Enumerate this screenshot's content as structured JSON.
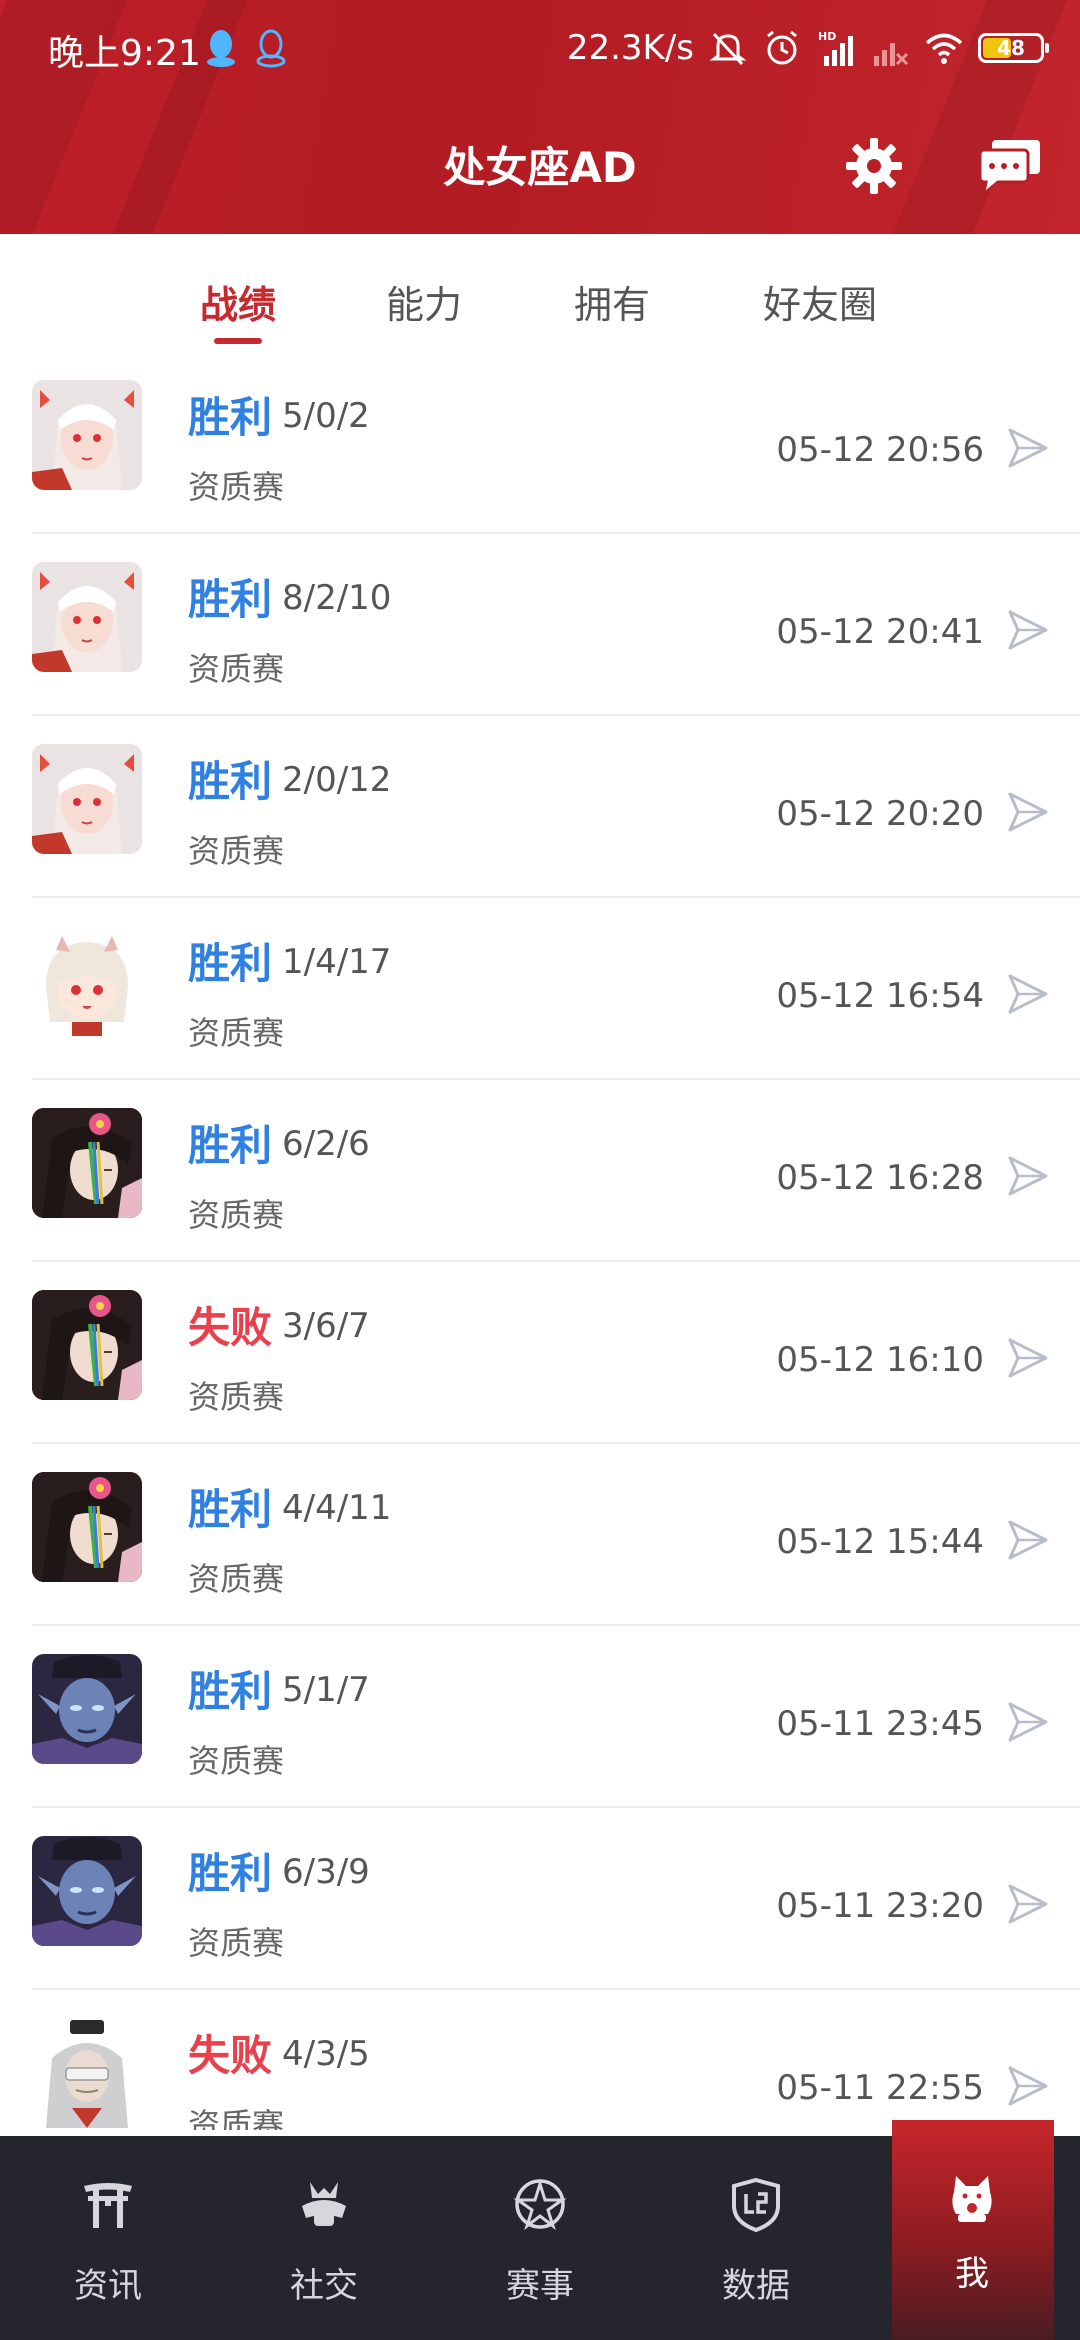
{
  "status_bar": {
    "time": "晚上9:21",
    "net_speed": "22.3K/s",
    "battery": "48",
    "icons": [
      "qq-icon",
      "qq-outline-icon",
      "mute-icon",
      "alarm-icon",
      "hd-signal-icon",
      "signal-off-icon",
      "wifi-icon",
      "battery-icon"
    ]
  },
  "header": {
    "title": "处女座AD",
    "settings_icon": "gear-icon",
    "message_icon": "chat-icon"
  },
  "tabs": [
    {
      "label": "战绩",
      "active": true
    },
    {
      "label": "能力",
      "active": false
    },
    {
      "label": "拥有",
      "active": false
    },
    {
      "label": "好友圈",
      "active": false
    }
  ],
  "matches": [
    {
      "avatar": "hero-white-hair",
      "result": "胜利",
      "win": true,
      "kda": "5/0/2",
      "mode": "资质赛",
      "time": "05-12 20:56"
    },
    {
      "avatar": "hero-white-hair",
      "result": "胜利",
      "win": true,
      "kda": "8/2/10",
      "mode": "资质赛",
      "time": "05-12 20:41"
    },
    {
      "avatar": "hero-white-hair",
      "result": "胜利",
      "win": true,
      "kda": "2/0/12",
      "mode": "资质赛",
      "time": "05-12 20:20"
    },
    {
      "avatar": "hero-chibi-girl",
      "result": "胜利",
      "win": true,
      "kda": "1/4/17",
      "mode": "资质赛",
      "time": "05-12 16:54"
    },
    {
      "avatar": "hero-flower-hair",
      "result": "胜利",
      "win": true,
      "kda": "6/2/6",
      "mode": "资质赛",
      "time": "05-12 16:28"
    },
    {
      "avatar": "hero-flower-hair",
      "result": "失败",
      "win": false,
      "kda": "3/6/7",
      "mode": "资质赛",
      "time": "05-12 16:10"
    },
    {
      "avatar": "hero-flower-hair",
      "result": "胜利",
      "win": true,
      "kda": "4/4/11",
      "mode": "资质赛",
      "time": "05-12 15:44"
    },
    {
      "avatar": "hero-blue-demon",
      "result": "胜利",
      "win": true,
      "kda": "5/1/7",
      "mode": "资质赛",
      "time": "05-11 23:45"
    },
    {
      "avatar": "hero-blue-demon",
      "result": "胜利",
      "win": true,
      "kda": "6/3/9",
      "mode": "资质赛",
      "time": "05-11 23:20"
    },
    {
      "avatar": "hero-masked-elder",
      "result": "失败",
      "win": false,
      "kda": "4/3/5",
      "mode": "资质赛",
      "time": "05-11 22:55"
    }
  ],
  "bottom_nav": [
    {
      "label": "资讯",
      "icon": "torii-gate-icon",
      "active": false
    },
    {
      "label": "社交",
      "icon": "samurai-helmet-icon",
      "active": false
    },
    {
      "label": "赛事",
      "icon": "pentagram-icon",
      "active": false
    },
    {
      "label": "数据",
      "icon": "shield-data-icon",
      "active": false
    },
    {
      "label": "我",
      "icon": "lucky-cat-icon",
      "active": true
    }
  ],
  "colors": {
    "header_red": "#c0202a",
    "win_blue": "#2f80e0",
    "lose_red": "#e8414d",
    "tab_active": "#c62a2e",
    "nav_bg": "#24252d"
  }
}
